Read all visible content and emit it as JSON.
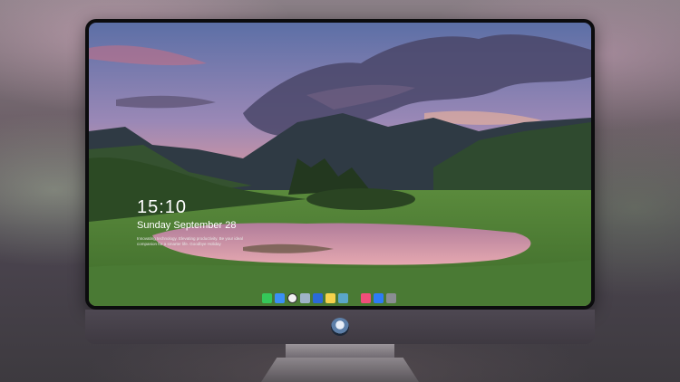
{
  "lock_screen": {
    "time": "15:10",
    "date": "Sunday September 28",
    "message": "Innovating technology. Elevating productivity. Be your ideal companion for a smarter life. Goodbye Holiday"
  },
  "dock": {
    "icons": [
      {
        "name": "messages-icon",
        "color": "#35c759"
      },
      {
        "name": "finder-icon",
        "color": "#3a8ff5"
      },
      {
        "name": "clock-icon",
        "color": "#f2f2f2"
      },
      {
        "name": "preview-icon",
        "color": "#9fb3c8"
      },
      {
        "name": "clapper-icon",
        "color": "#2a6ad8"
      },
      {
        "name": "notes-icon",
        "color": "#f5d24b"
      },
      {
        "name": "photos-icon",
        "color": "#5aa6c9"
      },
      {
        "name": "music-icon",
        "color": "#f04e7a"
      },
      {
        "name": "app-store-icon",
        "color": "#2d7cf6"
      },
      {
        "name": "camera-icon",
        "color": "#8a8d92"
      }
    ]
  },
  "colors": {
    "sky_top": "#6a7fb6",
    "sky_pink": "#d98aa0",
    "mountain": "#2e3a42",
    "grass": "#5f8d3e",
    "lake": "#d89aaa"
  }
}
